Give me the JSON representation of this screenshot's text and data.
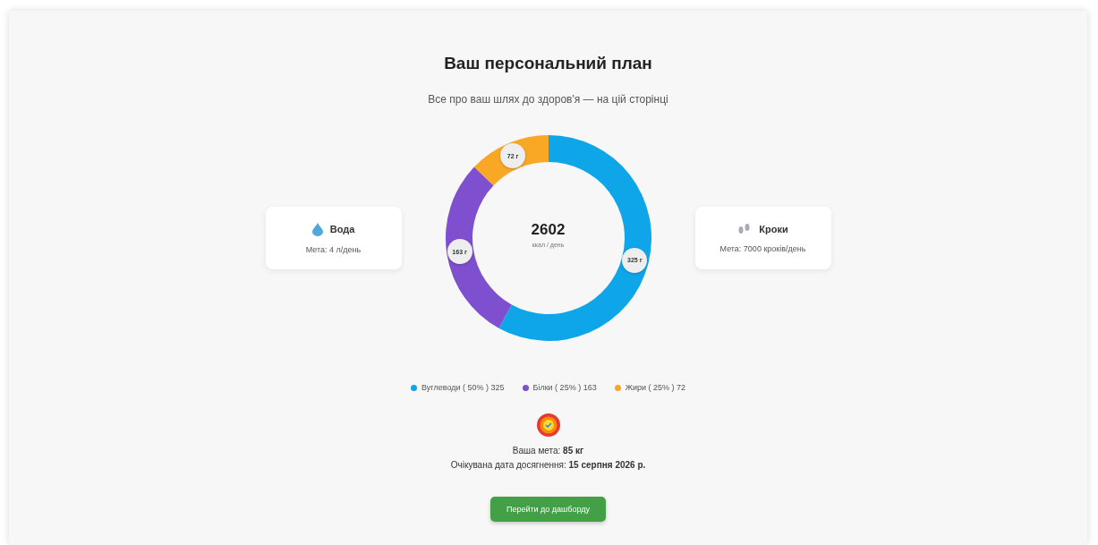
{
  "title": "Ваш персональний план",
  "subtitle": "Все про ваш шлях до здоров'я — на цій сторінці",
  "water": {
    "title": "Вода",
    "goal": "Мета: 4 л/день"
  },
  "steps": {
    "title": "Кроки",
    "goal": "Мета: 7000 кроків/день"
  },
  "calories": {
    "value": "2602",
    "unit": "ккал / день",
    "chart_data": {
      "type": "donut",
      "values": [
        325,
        163,
        72
      ],
      "value_labels": [
        "325 г",
        "163 г",
        "72 г"
      ]
    }
  },
  "legend": [
    {
      "label": "Вуглеводи ( 50% ) 325",
      "color": "#0ea5e9"
    },
    {
      "label": "Білки ( 25% ) 163",
      "color": "#7e4fcf"
    },
    {
      "label": "Жири ( 25% ) 72",
      "color": "#f9a825"
    }
  ],
  "goal_text": "Ваша мета: **85 кг**",
  "date_text": "Очікувана дата досягнення: **15 серпня 2026 р.**",
  "button": "Перейти до дашборду"
}
